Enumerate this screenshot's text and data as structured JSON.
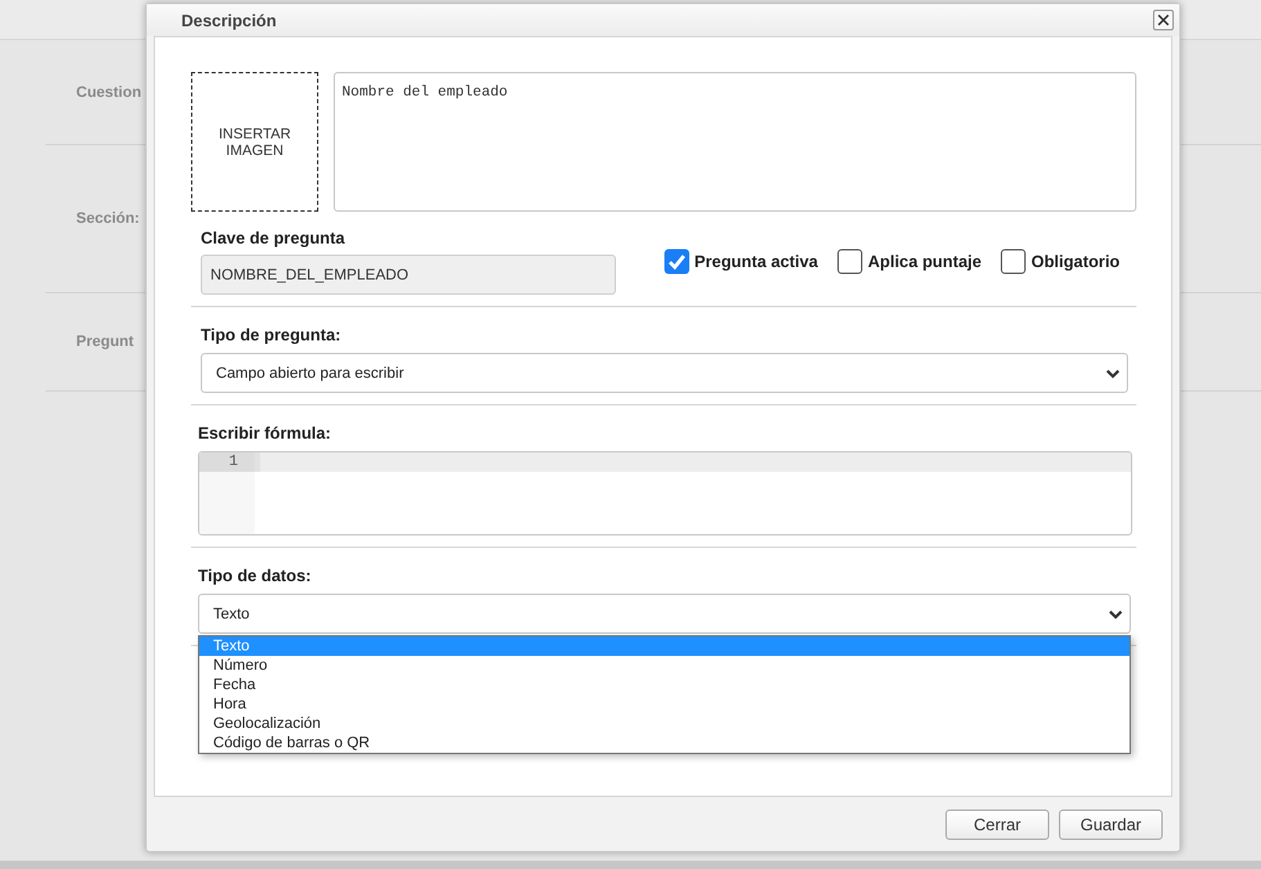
{
  "background": {
    "labels": [
      "Cuestion",
      "Sección:",
      "Pregunt"
    ]
  },
  "dialog": {
    "title": "Descripción",
    "image_placeholder": "INSERTAR IMAGEN",
    "description": {
      "value": "Nombre del empleado"
    },
    "question_key": {
      "label": "Clave de pregunta",
      "value": "NOMBRE_DEL_EMPLEADO"
    },
    "checkboxes": [
      {
        "label": "Pregunta activa",
        "checked": true
      },
      {
        "label": "Aplica puntaje",
        "checked": false
      },
      {
        "label": "Obligatorio",
        "checked": false
      }
    ],
    "question_type": {
      "label": "Tipo de pregunta:",
      "value": "Campo abierto para escribir"
    },
    "formula": {
      "label": "Escribir fórmula:",
      "line_numbers": [
        "1"
      ]
    },
    "data_type": {
      "label": "Tipo de datos:",
      "value": "Texto",
      "options": [
        {
          "label": "Texto",
          "selected": true
        },
        {
          "label": "Número",
          "selected": false
        },
        {
          "label": "Fecha",
          "selected": false
        },
        {
          "label": "Hora",
          "selected": false
        },
        {
          "label": "Geolocalización",
          "selected": false
        },
        {
          "label": "Código de barras o QR",
          "selected": false
        }
      ]
    },
    "buttons": [
      "Cerrar",
      "Guardar"
    ]
  }
}
